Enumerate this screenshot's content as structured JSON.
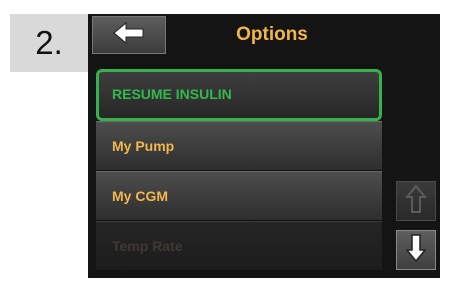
{
  "step": {
    "number": "2."
  },
  "header": {
    "back_icon": "arrow-left-icon",
    "title": "Options"
  },
  "menu": {
    "items": [
      {
        "label": "RESUME INSULIN",
        "state": "selected"
      },
      {
        "label": "My Pump",
        "state": "normal"
      },
      {
        "label": "My CGM",
        "state": "normal"
      },
      {
        "label": "Temp Rate",
        "state": "disabled"
      }
    ]
  },
  "scroll": {
    "up_icon": "arrow-up-icon",
    "down_icon": "arrow-down-icon"
  },
  "colors": {
    "accent": "#f2b74c",
    "selected": "#35b24a",
    "screen_bg": "#141414"
  }
}
